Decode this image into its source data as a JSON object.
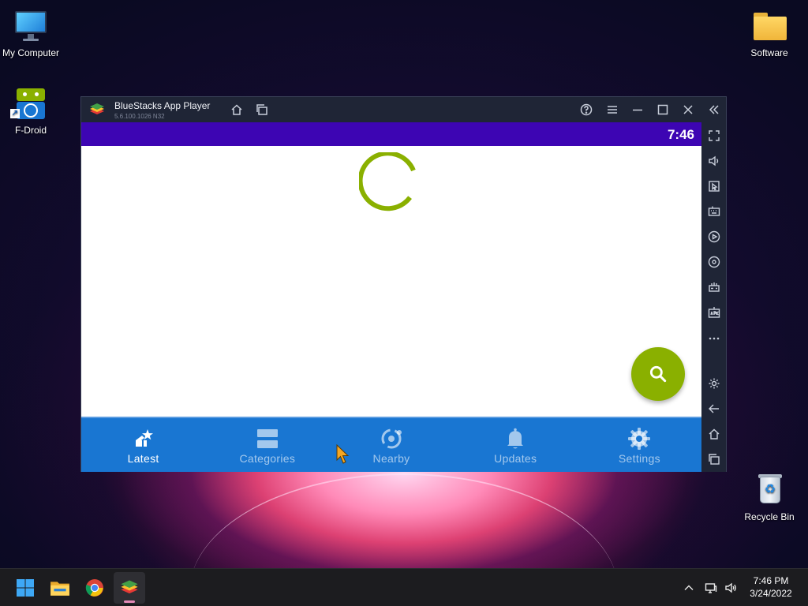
{
  "desktop": {
    "icons": [
      {
        "label": "My Computer",
        "icon": "monitor-icon"
      },
      {
        "label": "F-Droid",
        "icon": "fdroid-icon"
      },
      {
        "label": "Software",
        "icon": "folder-icon"
      },
      {
        "label": "Recycle Bin",
        "icon": "recycle-bin-icon"
      }
    ]
  },
  "window": {
    "title": "BlueStacks App Player",
    "version": "5.6.100.1026  N32",
    "title_buttons": [
      "home-icon",
      "multi-instance-icon",
      "help-icon",
      "menu-icon",
      "minimize-icon",
      "maximize-icon",
      "close-icon",
      "collapse-sidebar-icon"
    ],
    "sidebar_tools": [
      "fullscreen-icon",
      "volume-icon",
      "pointer-icon",
      "keyboard-icon",
      "macro-record-icon",
      "screen-record-icon",
      "gamepad-icon",
      "apk-install-icon",
      "more-icon",
      "settings-icon",
      "back-icon",
      "home-icon",
      "recent-apps-icon"
    ]
  },
  "android": {
    "status_time": "7:46",
    "status_color": "#3d05b3",
    "accent_color": "#8ab000",
    "nav_color": "#1976d2",
    "fab_icon": "search-icon",
    "nav": [
      {
        "label": "Latest",
        "icon": "latest-icon",
        "active": true
      },
      {
        "label": "Categories",
        "icon": "categories-icon",
        "active": false
      },
      {
        "label": "Nearby",
        "icon": "nearby-icon",
        "active": false
      },
      {
        "label": "Updates",
        "icon": "bell-icon",
        "active": false
      },
      {
        "label": "Settings",
        "icon": "gear-icon",
        "active": false
      }
    ]
  },
  "taskbar": {
    "apps": [
      "start-icon",
      "file-explorer-icon",
      "chrome-icon",
      "bluestacks-icon"
    ],
    "active_app": "bluestacks-icon",
    "tray": [
      "chevron-up-icon",
      "network-icon",
      "volume-icon"
    ],
    "time": "7:46 PM",
    "date": "3/24/2022"
  }
}
